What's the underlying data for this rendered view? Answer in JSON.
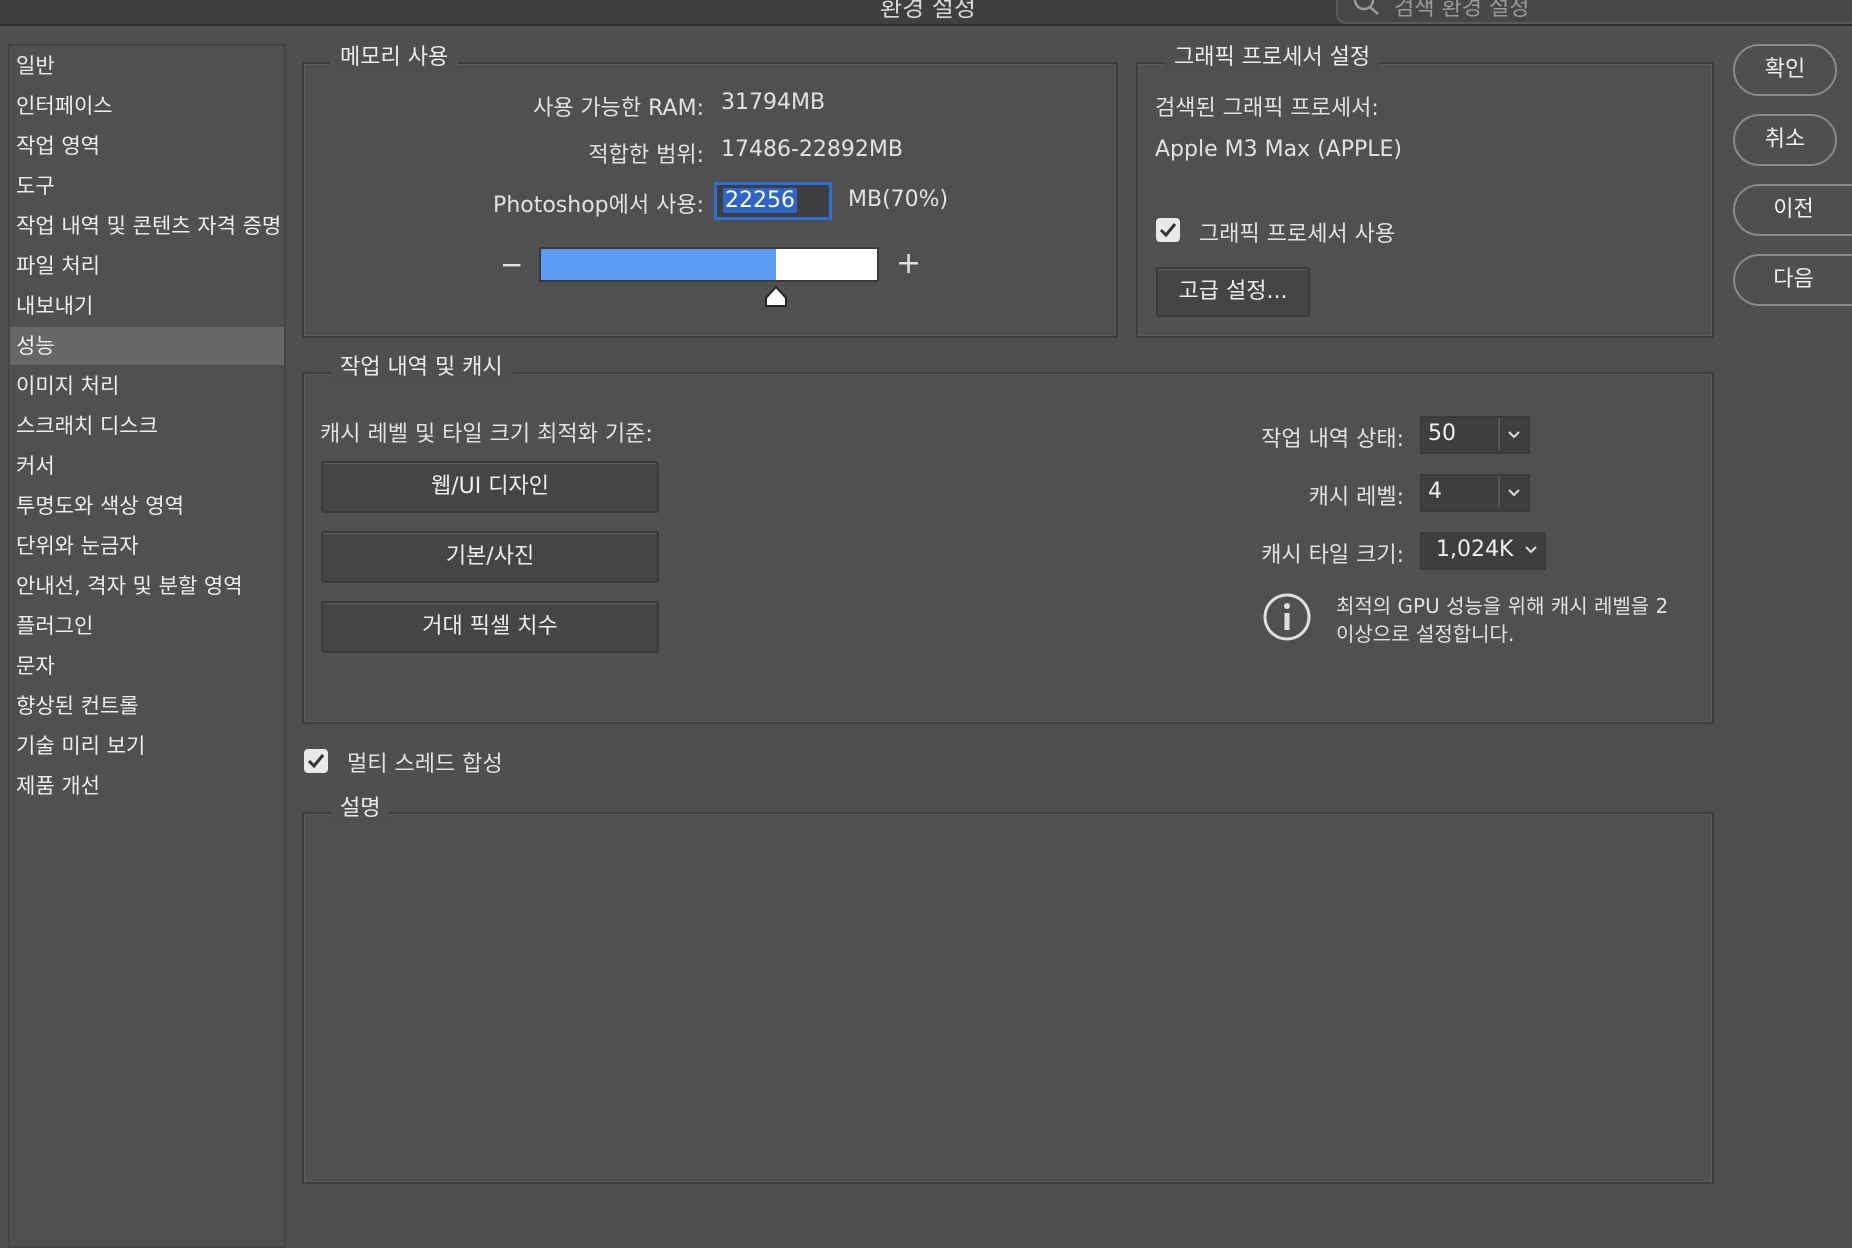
{
  "window": {
    "title": "환경 설정",
    "search_placeholder": "검색 환경 설정"
  },
  "sidebar": {
    "items": [
      {
        "label": "일반"
      },
      {
        "label": "인터페이스"
      },
      {
        "label": "작업 영역"
      },
      {
        "label": "도구"
      },
      {
        "label": "작업 내역 및 콘텐츠 자격 증명"
      },
      {
        "label": "파일 처리"
      },
      {
        "label": "내보내기"
      },
      {
        "label": "성능",
        "selected": true
      },
      {
        "label": "이미지 처리"
      },
      {
        "label": "스크래치 디스크"
      },
      {
        "label": "커서"
      },
      {
        "label": "투명도와 색상 영역"
      },
      {
        "label": "단위와 눈금자"
      },
      {
        "label": "안내선, 격자 및 분할 영역"
      },
      {
        "label": "플러그인"
      },
      {
        "label": "문자"
      },
      {
        "label": "향상된 컨트롤"
      },
      {
        "label": "기술 미리 보기"
      },
      {
        "label": "제품 개선"
      }
    ]
  },
  "memory": {
    "legend": "메모리 사용",
    "available_label": "사용 가능한 RAM:",
    "available_value": "31794MB",
    "ideal_label": "적합한 범위:",
    "ideal_value": "17486-22892MB",
    "use_label": "Photoshop에서 사용:",
    "use_value": "22256",
    "use_suffix": "MB(70%)",
    "slider_fraction": 0.7,
    "minus": "−",
    "plus": "+"
  },
  "gpu": {
    "legend": "그래픽 프로세서 설정",
    "detected_label": "검색된 그래픽 프로세서:",
    "detected_value": "Apple M3 Max (APPLE)",
    "use_gpu_label": "그래픽 프로세서 사용",
    "use_gpu_checked": true,
    "advanced_button": "고급 설정..."
  },
  "history_cache": {
    "legend": "작업 내역 및 캐시",
    "optimize_label": "캐시 레벨 및 타일 크기 최적화 기준:",
    "preset_buttons": [
      "웹/UI 디자인",
      "기본/사진",
      "거대 픽셀 치수"
    ],
    "history_states_label": "작업 내역 상태:",
    "history_states_value": "50",
    "cache_levels_label": "캐시 레벨:",
    "cache_levels_value": "4",
    "cache_tile_label": "캐시 타일 크기:",
    "cache_tile_value": "1,024K",
    "info_text_1": "최적의 GPU 성능을 위해 캐시 레벨을 2",
    "info_text_2": "이상으로 설정합니다."
  },
  "multithread": {
    "label": "멀티 스레드 합성",
    "checked": true
  },
  "description": {
    "legend": "설명"
  },
  "actions": {
    "ok": "확인",
    "cancel": "취소",
    "prev": "이전",
    "next": "다음"
  },
  "colors": {
    "panel_bg": "#505050",
    "slider_fill": "#5b9cf2",
    "selection_blue": "#2d64c8"
  }
}
